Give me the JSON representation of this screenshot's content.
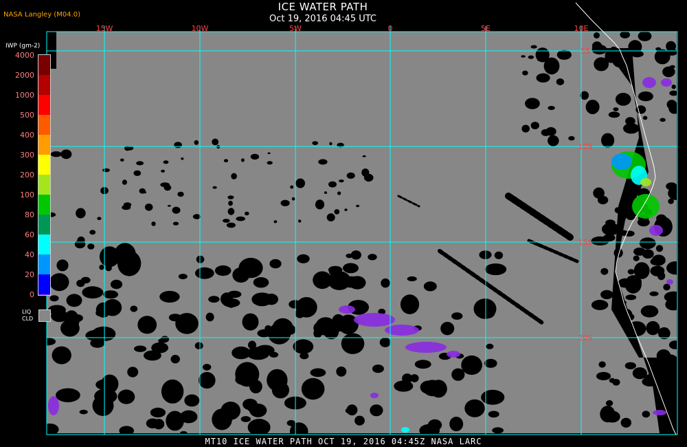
{
  "header": {
    "title": "ICE WATER PATH",
    "datetime": "Oct 19, 2016 04:45 UTC",
    "source": "NASA Langley (M04.0)"
  },
  "legend": {
    "title": "IWP (gm-2)",
    "ticks": [
      "4000",
      "2000",
      "1000",
      "500",
      "400",
      "300",
      "200",
      "100",
      "80",
      "60",
      "40",
      "20",
      "0"
    ],
    "colors": [
      "#7a0000",
      "#b30000",
      "#ff0000",
      "#ff5a00",
      "#ff9d00",
      "#ffff00",
      "#a4e61e",
      "#00c800",
      "#009653",
      "#00ffff",
      "#0096ff",
      "#0000ff",
      "#8a2be2"
    ],
    "liquid_label_line1": "LIQ",
    "liquid_label_line2": "CLD",
    "liquid_color": "#878787"
  },
  "map": {
    "longitude_labels": [
      "15W",
      "10W",
      "5W",
      "0",
      "5E",
      "10E"
    ],
    "latitude_labels": [
      "5S",
      "10S",
      "15S",
      "20S"
    ],
    "grid_color": "#00ffff",
    "label_color": "#ff4040",
    "cloud_color": "#878787",
    "clear_color": "#000000",
    "coast_color": "#ffffff"
  },
  "footer": {
    "text": "MT10  ICE WATER PATH   OCT 19, 2016 04:45Z   NASA LARC"
  }
}
